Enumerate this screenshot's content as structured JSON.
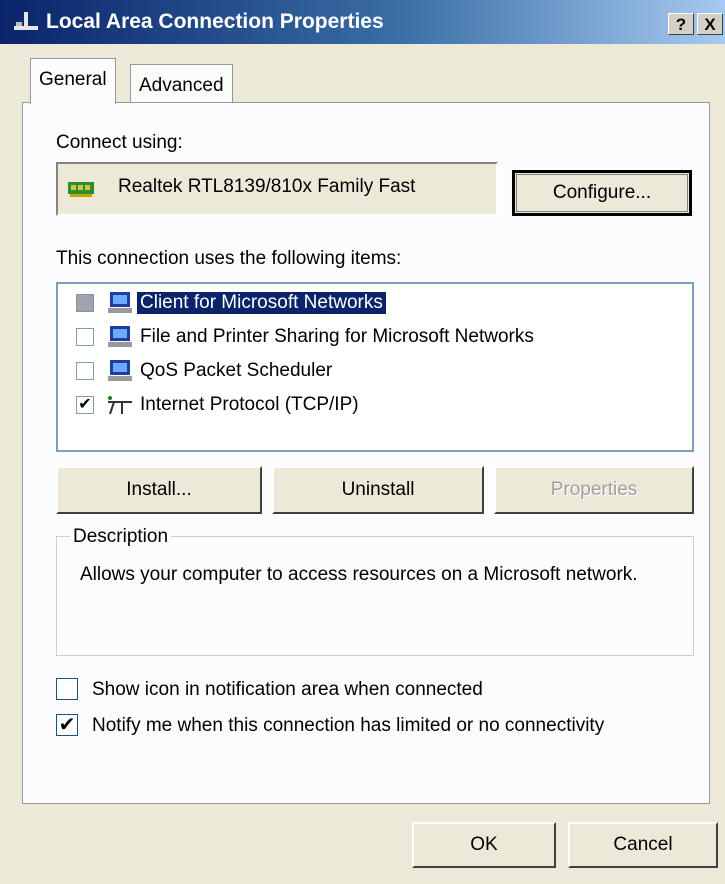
{
  "window": {
    "title": "Local Area Connection Properties",
    "help_button": "?",
    "close_button": "X"
  },
  "tabs": [
    {
      "label": "General",
      "active": true
    },
    {
      "label": "Advanced",
      "active": false
    }
  ],
  "connect_using": {
    "label": "Connect using:",
    "adapter_icon": "network-card-icon",
    "adapter_name": "Realtek RTL8139/810x Family Fast",
    "configure_button": "Configure..."
  },
  "items_section": {
    "label": "This connection uses the following items:",
    "items": [
      {
        "label": "Client for Microsoft Networks",
        "checked": "indeterminate",
        "icon": "computer-network-icon",
        "selected": true
      },
      {
        "label": "File and Printer Sharing for Microsoft Networks",
        "checked": false,
        "icon": "computer-network-icon",
        "selected": false
      },
      {
        "label": "QoS Packet Scheduler",
        "checked": false,
        "icon": "computer-network-icon",
        "selected": false
      },
      {
        "label": "Internet Protocol (TCP/IP)",
        "checked": true,
        "icon": "protocol-icon",
        "selected": false
      }
    ],
    "install_button": "Install...",
    "uninstall_button": "Uninstall",
    "properties_button": "Properties"
  },
  "description": {
    "legend": "Description",
    "text": "Allows your computer to access resources on a Microsoft network."
  },
  "options": [
    {
      "label": "Show icon in notification area when connected",
      "checked": false
    },
    {
      "label": "Notify me when this connection has limited or no connectivity",
      "checked": true
    }
  ],
  "footer": {
    "ok_button": "OK",
    "cancel_button": "Cancel"
  },
  "colors": {
    "dialog_bg": "#ece9d8",
    "titlebar_start": "#0a246a",
    "titlebar_end": "#a6caf0",
    "selection_bg": "#0a246a"
  }
}
